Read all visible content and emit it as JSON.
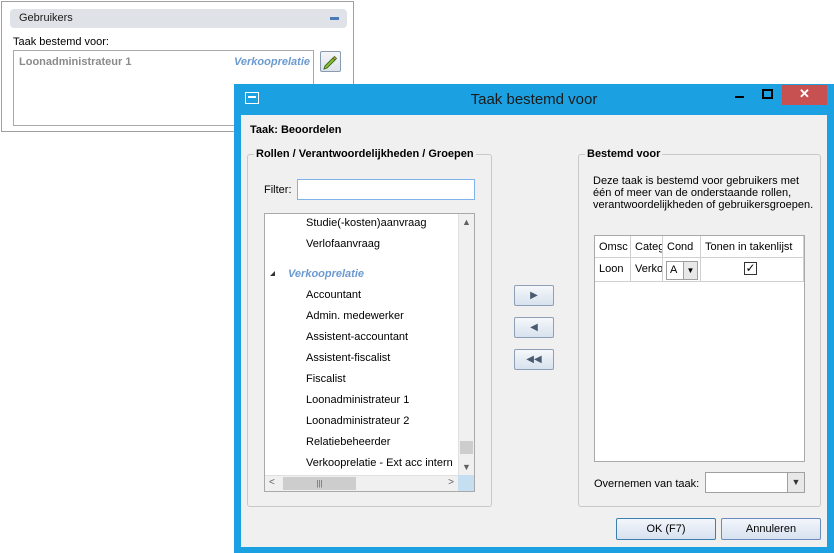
{
  "background_panel": {
    "header_title": "Gebruikers",
    "field_label": "Taak bestemd voor:",
    "list_item": "Loonadministrateur 1",
    "list_item_tag": "Verkooprelatie"
  },
  "dialog": {
    "title": "Taak bestemd voor",
    "task_label": "Taak: Beoordelen",
    "left_group": {
      "title": "Rollen / Verantwoordelijkheden / Groepen",
      "filter_label": "Filter:",
      "filter_value": "",
      "tree_items": [
        "Studie(-kosten)aanvraag",
        "Verlofaanvraag",
        "Accountant",
        "Admin. medewerker",
        "Assistent-accountant",
        "Assistent-fiscalist",
        "Fiscalist",
        "Loonadministrateur 1",
        "Loonadministrateur 2",
        "Relatiebeheerder",
        "Verkooprelatie - Ext acc intern"
      ],
      "tree_group": "Verkooprelatie"
    },
    "right_group": {
      "title": "Bestemd voor",
      "description": "Deze taak is bestemd voor gebruikers met één of meer van de onderstaande rollen, verantwoordelijkheden of gebruikersgroepen.",
      "columns": [
        "Omsc",
        "Categ",
        "Cond",
        "Tonen in takenlijst"
      ],
      "row": {
        "omschrijving": "Loon",
        "categorie": "Verko",
        "conditie": "A",
        "tonen": "✓"
      },
      "copy_label": "Overnemen van taak:",
      "copy_value": ""
    },
    "buttons": {
      "ok": "OK  (F7)",
      "cancel": "Annuleren",
      "add": "▶",
      "remove": "◀",
      "remove_all": "◀◀"
    }
  },
  "icons": {
    "collapse": "minus-icon",
    "edit": "pencil-icon",
    "window": "window-icon"
  },
  "colors": {
    "dialog_frame": "#1ba1e2",
    "close_button": "#c75050",
    "tag_blue": "#6b9ad2"
  }
}
